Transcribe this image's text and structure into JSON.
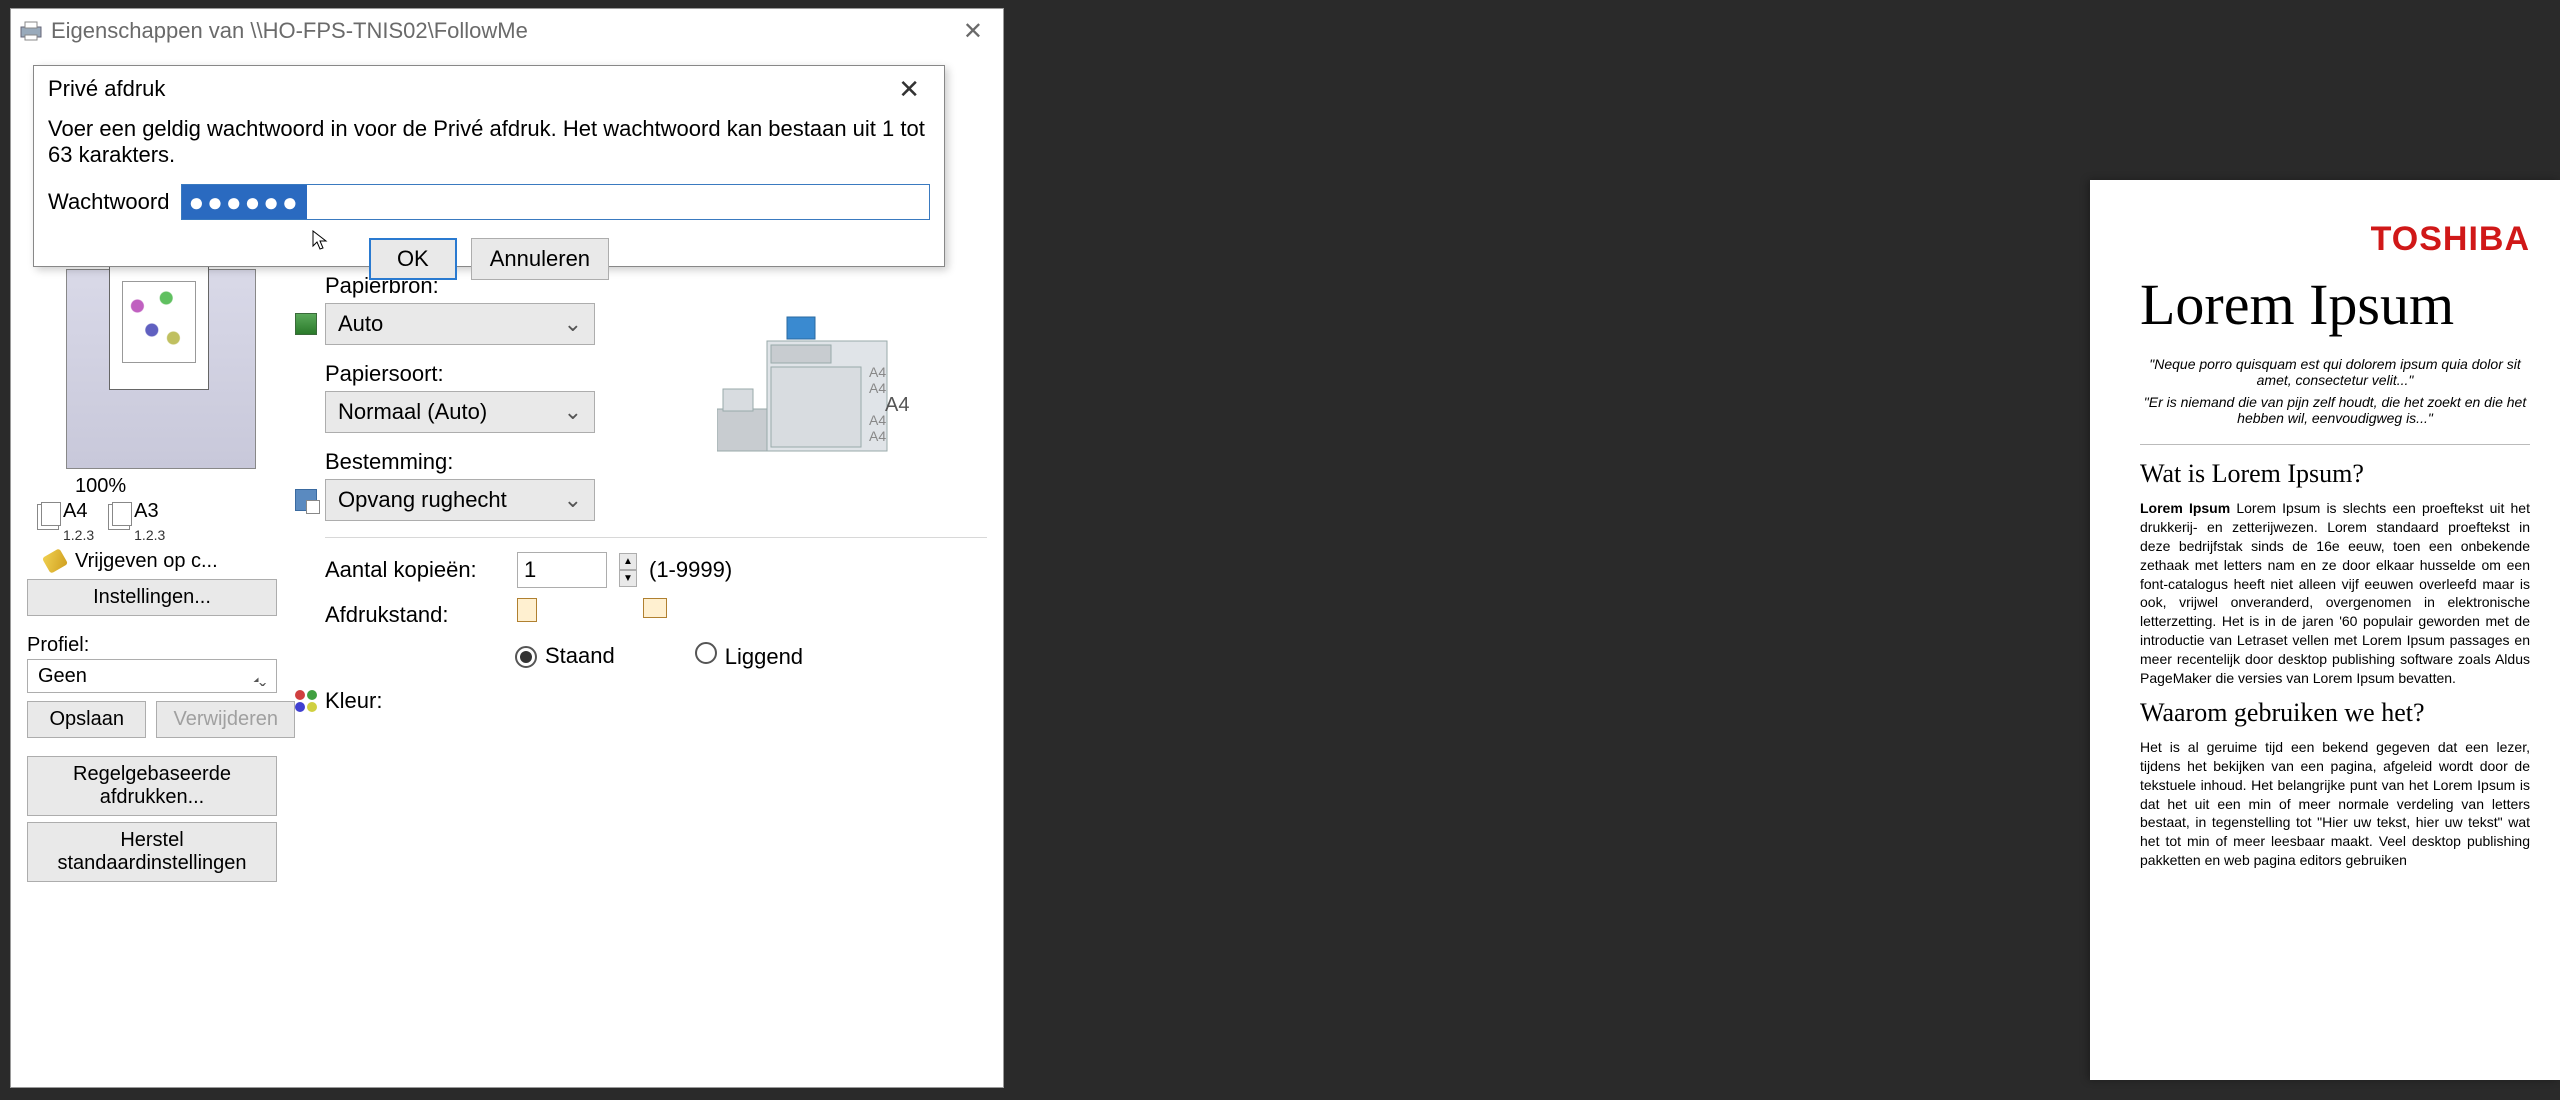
{
  "window": {
    "title": "Eigenschappen van \\\\HO-FPS-TNIS02\\FollowMe"
  },
  "modal": {
    "title": "Privé afdruk",
    "message": "Voer een geldig wachtwoord in voor de Privé afdruk. Het wachtwoord kan bestaan uit 1 tot 63 karakters.",
    "password_label": "Wachtwoord",
    "password_mask": "●●●●●●",
    "ok": "OK",
    "cancel": "Annuleren"
  },
  "preview": {
    "zoom": "100%",
    "size1": "A4",
    "size1_sub": "1.2.3",
    "size2": "A3",
    "size2_sub": "1.2.3",
    "release": "Vrijgeven op c..."
  },
  "left": {
    "settings_btn": "Instellingen...",
    "profile_label": "Profiel:",
    "profile_value": "Geen",
    "save": "Opslaan",
    "delete": "Verwijderen",
    "rule_print": "Regelgebaseerde afdrukken...",
    "restore": "Herstel standaardinstellingen"
  },
  "right": {
    "paper_source_label": "Papierbron:",
    "paper_source_value": "Auto",
    "paper_type_label": "Papiersoort:",
    "paper_type_value": "Normaal (Auto)",
    "destination_label": "Bestemming:",
    "destination_value": "Opvang rughecht",
    "copies_label": "Aantal kopieën:",
    "copies_value": "1",
    "copies_range": "(1-9999)",
    "orientation_label": "Afdrukstand:",
    "orientation_portrait": "Staand",
    "orientation_landscape": "Liggend",
    "color_label": "Kleur:",
    "tray_label": "A4"
  },
  "doc": {
    "brand": "TOSHIBA",
    "h1": "Lorem Ipsum",
    "quote1": "\"Neque porro quisquam est qui dolorem ipsum quia dolor sit amet, consectetur velit...\"",
    "quote2": "\"Er is niemand die van pijn zelf houdt, die het zoekt en die het hebben wil, eenvoudigweg is...\"",
    "h2a": "Wat is Lorem Ipsum?",
    "p1": "Lorem Ipsum is slechts een proeftekst uit het drukkerij- en zetterijwezen. Lorem standaard proeftekst in deze bedrijfstak sinds de 16e eeuw, toen een onbekende zethaak met letters nam en ze door elkaar husselde om een font-catalogus heeft niet alleen vijf eeuwen overleefd maar is ook, vrijwel onveranderd, overgenomen in elektronische letterzetting. Het is in de jaren '60 populair geworden met de introductie van Letraset vellen met Lorem Ipsum passages en meer recentelijk door desktop publishing software zoals Aldus PageMaker die versies van Lorem Ipsum bevatten.",
    "h2b": "Waarom gebruiken we het?",
    "p2": "Het is al geruime tijd een bekend gegeven dat een lezer, tijdens het bekijken van een pagina, afgeleid wordt door de tekstuele inhoud. Het belangrijke punt van het Lorem Ipsum is dat het uit een min of meer normale verdeling van letters bestaat, in tegenstelling tot \"Hier uw tekst, hier uw tekst\" wat het tot min of meer leesbaar maakt. Veel desktop publishing pakketten en web pagina editors gebruiken"
  }
}
